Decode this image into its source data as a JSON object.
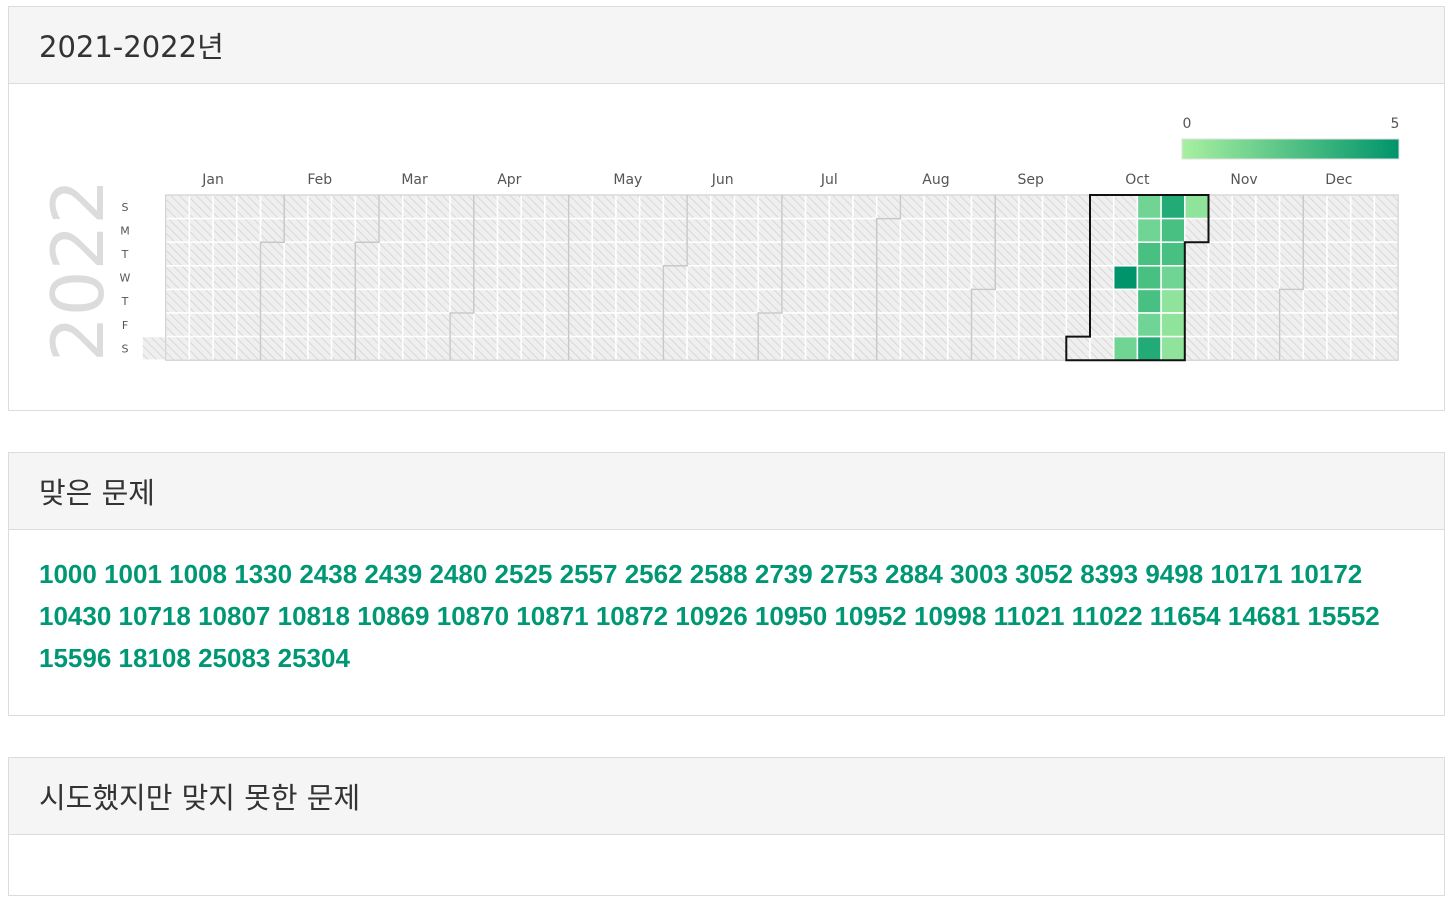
{
  "calendar": {
    "header_title": "2021-2022년",
    "year_label": "2022",
    "legend": {
      "min": "0",
      "max": "5",
      "low_color": "#a8f0a0",
      "high_color": "#00946b"
    },
    "months": [
      "Jan",
      "Feb",
      "Mar",
      "Apr",
      "May",
      "Jun",
      "Jul",
      "Aug",
      "Sep",
      "Oct",
      "Nov",
      "Dec"
    ],
    "weekdays": [
      "S",
      "M",
      "T",
      "W",
      "T",
      "F",
      "S"
    ],
    "highlighted_month": "Oct",
    "activity": [
      {
        "date": "2022-10-12",
        "level": 5
      },
      {
        "date": "2022-10-15",
        "level": 2
      },
      {
        "date": "2022-10-16",
        "level": 2
      },
      {
        "date": "2022-10-17",
        "level": 2
      },
      {
        "date": "2022-10-18",
        "level": 3
      },
      {
        "date": "2022-10-19",
        "level": 3
      },
      {
        "date": "2022-10-20",
        "level": 3
      },
      {
        "date": "2022-10-21",
        "level": 2
      },
      {
        "date": "2022-10-22",
        "level": 4
      },
      {
        "date": "2022-10-23",
        "level": 4
      },
      {
        "date": "2022-10-24",
        "level": 3
      },
      {
        "date": "2022-10-25",
        "level": 3
      },
      {
        "date": "2022-10-26",
        "level": 2
      },
      {
        "date": "2022-10-27",
        "level": 1
      },
      {
        "date": "2022-10-28",
        "level": 1
      },
      {
        "date": "2022-10-29",
        "level": 1
      },
      {
        "date": "2022-10-30",
        "level": 1
      }
    ]
  },
  "solved": {
    "title": "맞은 문제",
    "problems": [
      "1000",
      "1001",
      "1008",
      "1330",
      "2438",
      "2439",
      "2480",
      "2525",
      "2557",
      "2562",
      "2588",
      "2739",
      "2753",
      "2884",
      "3003",
      "3052",
      "8393",
      "9498",
      "10171",
      "10172",
      "10430",
      "10718",
      "10807",
      "10818",
      "10869",
      "10870",
      "10871",
      "10872",
      "10926",
      "10950",
      "10952",
      "10998",
      "11021",
      "11022",
      "11654",
      "14681",
      "15552",
      "15596",
      "18108",
      "25083",
      "25304"
    ]
  },
  "failed": {
    "title": "시도했지만 맞지 못한 문제",
    "problems": []
  }
}
